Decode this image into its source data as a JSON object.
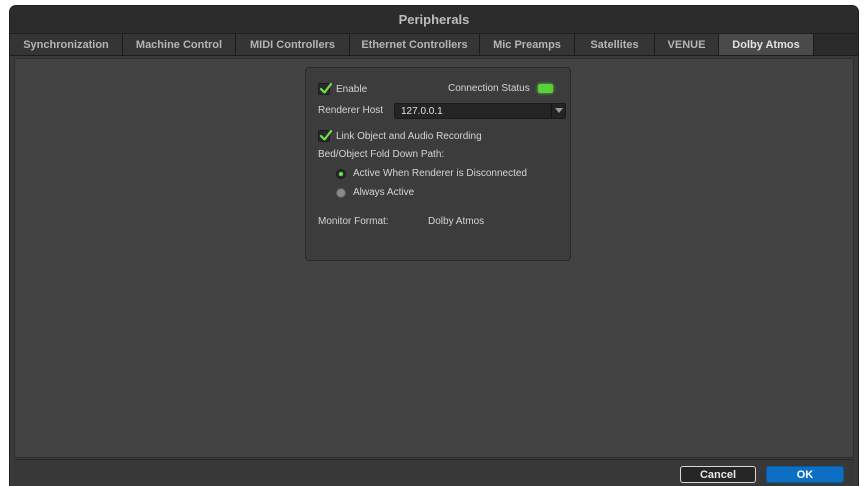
{
  "window": {
    "title": "Peripherals"
  },
  "tabs": [
    {
      "label": "Synchronization",
      "active": false
    },
    {
      "label": "Machine Control",
      "active": false
    },
    {
      "label": "MIDI Controllers",
      "active": false
    },
    {
      "label": "Ethernet Controllers",
      "active": false
    },
    {
      "label": "Mic Preamps",
      "active": false
    },
    {
      "label": "Satellites",
      "active": false
    },
    {
      "label": "VENUE",
      "active": false
    },
    {
      "label": "Dolby Atmos",
      "active": true
    }
  ],
  "atmos": {
    "enable_label": "Enable",
    "enable_checked": true,
    "connection_status_label": "Connection Status",
    "connection_status_color": "#59d23a",
    "renderer_host_label": "Renderer Host",
    "renderer_host_value": "127.0.0.1",
    "link_label": "Link Object and Audio Recording",
    "link_checked": true,
    "fold_down_label": "Bed/Object Fold Down Path:",
    "radio_options": [
      {
        "label": "Active When Renderer is Disconnected",
        "selected": true
      },
      {
        "label": "Always Active",
        "selected": false
      }
    ],
    "monitor_format_label": "Monitor Format:",
    "monitor_format_value": "Dolby Atmos"
  },
  "footer": {
    "cancel_label": "Cancel",
    "ok_label": "OK"
  },
  "colors": {
    "accent": "#0d6fc4",
    "check": "#6ee24a",
    "led": "#59d23a"
  }
}
